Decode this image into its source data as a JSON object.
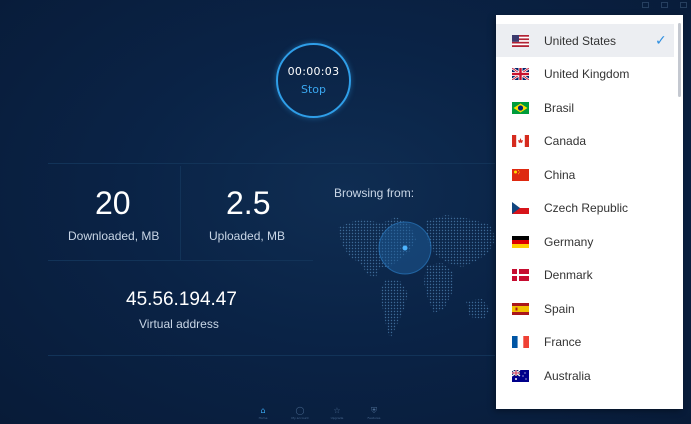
{
  "timer": {
    "elapsed": "00:00:03",
    "action_label": "Stop"
  },
  "stats": {
    "downloaded_value": "20",
    "downloaded_label": "Downloaded, MB",
    "uploaded_value": "2.5",
    "uploaded_label": "Uploaded, MB",
    "virtual_ip": "45.56.194.47",
    "virtual_ip_label": "Virtual address"
  },
  "browsing_label": "Browsing from:",
  "colors": {
    "background": "#0a2346",
    "accent": "#2f9ee8",
    "check": "#2f8fe0"
  },
  "bottom_nav": [
    {
      "label": "Home",
      "icon": "home-icon",
      "active": true
    },
    {
      "label": "My account",
      "icon": "user-icon",
      "active": false
    },
    {
      "label": "Upgrade",
      "icon": "star-icon",
      "active": false
    },
    {
      "label": "Features",
      "icon": "shield-icon",
      "active": false
    }
  ],
  "countries": [
    {
      "name": "United States",
      "flag": "us-flag-icon",
      "selected": true
    },
    {
      "name": "United Kingdom",
      "flag": "uk-flag-icon",
      "selected": false
    },
    {
      "name": "Brasil",
      "flag": "br-flag-icon",
      "selected": false
    },
    {
      "name": "Canada",
      "flag": "ca-flag-icon",
      "selected": false
    },
    {
      "name": "China",
      "flag": "cn-flag-icon",
      "selected": false
    },
    {
      "name": "Czech Republic",
      "flag": "cz-flag-icon",
      "selected": false
    },
    {
      "name": "Germany",
      "flag": "de-flag-icon",
      "selected": false
    },
    {
      "name": "Denmark",
      "flag": "dk-flag-icon",
      "selected": false
    },
    {
      "name": "Spain",
      "flag": "es-flag-icon",
      "selected": false
    },
    {
      "name": "France",
      "flag": "fr-flag-icon",
      "selected": false
    },
    {
      "name": "Australia",
      "flag": "au-flag-icon",
      "selected": false
    }
  ]
}
